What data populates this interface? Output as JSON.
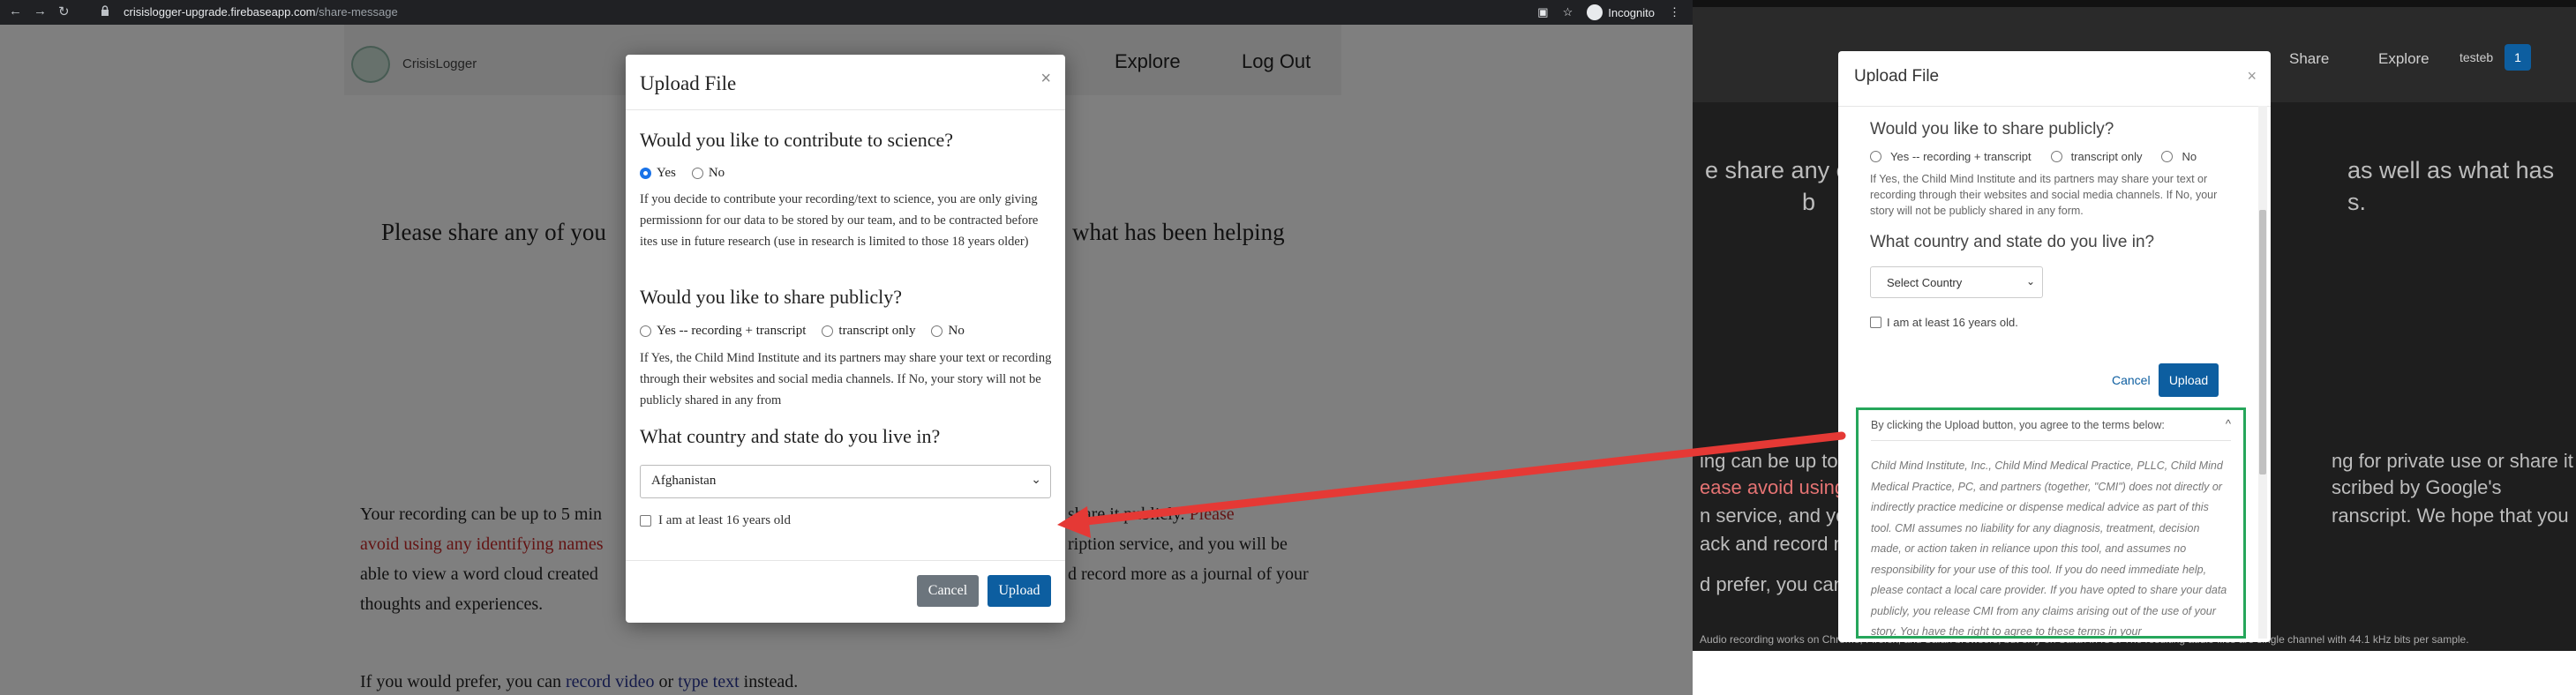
{
  "browser": {
    "url_host": "crisislogger-upgrade.firebaseapp.com",
    "url_path": "/share-message",
    "profile": "Incognito"
  },
  "site": {
    "logo_text": "CrisisLogger",
    "nav": [
      "Explore",
      "Log Out"
    ],
    "hero_question": "Please share any of you",
    "hero_tail": "what has been helping",
    "para1_a": "Your recording can be up to 5 min",
    "para1_b": "share it publicly. ",
    "para1_red_a": "Please",
    "para2_red": "avoid using any identifying names",
    "para2_b": "ription service, and you will be",
    "para3_a": "able to view a word cloud created",
    "para3_b": "d record more as a journal of your",
    "para4": "thoughts and experiences.",
    "para5_a": "If you would prefer, you can ",
    "para5_link1": "record video",
    "para5_or": " or ",
    "para5_link2": "type text",
    "para5_end": " instead."
  },
  "modal_left": {
    "title": "Upload File",
    "close": "×",
    "q1": "Would you like to contribute to science?",
    "q1_opt_yes": "Yes",
    "q1_opt_no": "No",
    "q1_help": "If you decide to contribute your recording/text to science, you are only giving permissionn for our data to be stored by our team, and to be contracted before ites use in future research (use in research is limited to those 18 years older)",
    "q2": "Would you like to share publicly?",
    "q2_opt1": "Yes -- recording + transcript",
    "q2_opt2": "transcript only",
    "q2_opt3": "No",
    "q2_help": "If Yes, the Child Mind Institute and its partners may share your text or recording through their websites and social media channels. If No, your story will not be publicly shared in any from",
    "q3": "What country and state do you live in?",
    "country_value": "Afghanistan",
    "age_label": "I am at least 16 years old",
    "cancel": "Cancel",
    "upload": "Upload"
  },
  "right_panel": {
    "nav": [
      "Share",
      "Explore"
    ],
    "user": "testeb",
    "badge": "1",
    "hero_a": "e share any o",
    "hero_b": "as well as what has",
    "hero_c": "b",
    "hero_d": "s.",
    "body1_a": "ing can be up to ",
    "body1_b": "ng for private use or share it",
    "body2_red": "ease avoid using",
    "body2_b": "scribed by Google's",
    "body3_a": "n service, and yo",
    "body3_b": "ranscript. We hope that you",
    "body4": "ack and record m",
    "body5": "d prefer, you can",
    "footnote": "Audio recording works on Chrome, Firefox, and Safari browsers, but only on Safari in iOS. The resulting audio files are single channel with 44.1 kHz bits per sample."
  },
  "modal_right": {
    "title": "Upload File",
    "close": "×",
    "q2": "Would you like to share publicly?",
    "opt1": "Yes -- recording + transcript",
    "opt2": "transcript only",
    "opt3": "No",
    "help": "If Yes, the Child Mind Institute and its partners may share your text or recording through their websites and social media channels. If No, your story will not be publicly shared in any form.",
    "q3": "What country and state do you live in?",
    "country_placeholder": "Select Country",
    "age_label": "I am at least 16 years old.",
    "cancel": "Cancel",
    "upload": "Upload",
    "terms_header": "By clicking the Upload button, you agree to the terms below:",
    "terms_caret": "^",
    "terms_body": "Child Mind Institute, Inc., Child Mind Medical Practice, PLLC, Child Mind Medical Practice, PC, and partners (together, \"CMI\") does not directly or indirectly practice medicine or dispense medical advice as part of this tool. CMI assumes no liability for any diagnosis, treatment, decision made, or action taken in reliance upon this tool, and assumes no responsibility for your use of this tool. If you do need immediate help, please contact a local care provider. If you have opted to share your data publicly, you release CMI from any claims arising out of the use of your story. You have the right to agree to these terms in your"
  },
  "colors": {
    "primary": "#0d5ea0",
    "annotation_arrow": "#e53935",
    "terms_border": "#26a65b",
    "warning_text": "#c62828"
  }
}
